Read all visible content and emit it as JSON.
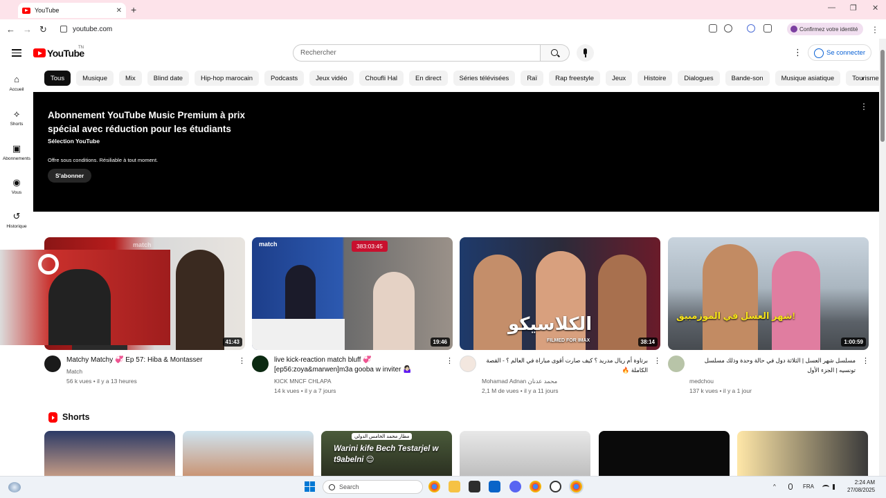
{
  "browser": {
    "tab_title": "YouTube",
    "tab_close": "✕",
    "new_tab": "+",
    "window_controls": [
      "—",
      "❐",
      "✕"
    ],
    "url": "youtube.com",
    "profile_label": "Confirmez votre identité",
    "menu": "⋮",
    "nav": [
      "←",
      "→",
      "↻"
    ]
  },
  "header": {
    "logo": "YouTube",
    "country_code": "TN",
    "search_placeholder": "Rechercher",
    "more": "⋮",
    "signin": "Se connecter"
  },
  "guide": [
    {
      "label": "Accueil",
      "icon": "home-icon",
      "glyph": "⌂"
    },
    {
      "label": "Shorts",
      "icon": "shorts-icon",
      "glyph": "⟡"
    },
    {
      "label": "Abonnements",
      "icon": "subscriptions-icon",
      "glyph": "▣"
    },
    {
      "label": "Vous",
      "icon": "you-icon",
      "glyph": "◉"
    },
    {
      "label": "Historique",
      "icon": "history-icon",
      "glyph": "↺"
    }
  ],
  "chips": [
    "Tous",
    "Musique",
    "Mix",
    "Blind date",
    "Hip-hop marocain",
    "Podcasts",
    "Jeux vidéo",
    "Choufli Hal",
    "En direct",
    "Séries télévisées",
    "Raï",
    "Rap freestyle",
    "Jeux",
    "Histoire",
    "Dialogues",
    "Bande-son",
    "Musique asiatique",
    "Tourisme"
  ],
  "chips_next": "›",
  "banner": {
    "title": "Abonnement YouTube Music Premium à prix spécial avec réduction pour les étudiants",
    "subtitle": "Sélection YouTube",
    "conditions": "Offre sous conditions. Résiliable à tout moment.",
    "button": "S'abonner",
    "menu": "⋮"
  },
  "videos": [
    {
      "title": "Matchy Matchy 💞 Ep 57: Hiba & Montasser",
      "channel": "Match",
      "meta": "56 k vues • il y a 13 heures",
      "duration": "41:43",
      "overlay": "match",
      "menu": "⋮"
    },
    {
      "title": "live kick-reaction match bluff 💞 [ep56:zoya&marwen]m3a gooba w inviter 🤷🏻‍♀️",
      "channel": "KICK MNCF CHLAPA",
      "meta": "14 k vues • il y a 7 jours",
      "duration": "19:46",
      "live_counter": "383:03:45",
      "overlay": "match",
      "menu": "⋮"
    },
    {
      "title": "برتاوة أم ريال مدريد ؟ كيف صارت أقوى مباراة في العالم ؟ - القصة الكاملة 🔥",
      "channel": "Mohamad Adnan محمد عدنان",
      "meta": "2,1 M de vues • il y a 11 jours",
      "duration": "38:14",
      "overlay": "الكلاسيكو",
      "overlay_sub": "FILMED FOR IMAX",
      "menu": "⋮"
    },
    {
      "title": "مسلسل شهر العسل | الثلاثة دول في حالة وحدة وذلك مسلسل تونسيه | الجزء الأول",
      "channel": "medchou",
      "meta": "137 k vues • il y a 1 jour",
      "duration": "1:00:59",
      "overlay": "شهر العسل في الموزمبيق!",
      "menu": "⋮"
    }
  ],
  "shorts": {
    "title": "Shorts",
    "items": [
      {
        "caption": ""
      },
      {
        "caption": ""
      },
      {
        "caption": "Warini kife Bech Testarjel w t9abelni 😌",
        "tag": "مطار محمد الخامس الدولي"
      },
      {
        "caption": ""
      },
      {
        "caption": ""
      },
      {
        "caption": ""
      }
    ]
  },
  "taskbar": {
    "search_label": "Search",
    "language": "FRA",
    "time": "2:24 AM",
    "date": "27/08/2025",
    "tray_up": "^"
  },
  "colors": {
    "brand": "#ff0000",
    "banner_bg": "#000000",
    "link_blue": "#065fd4",
    "chip_bg": "#f2f2f2"
  }
}
